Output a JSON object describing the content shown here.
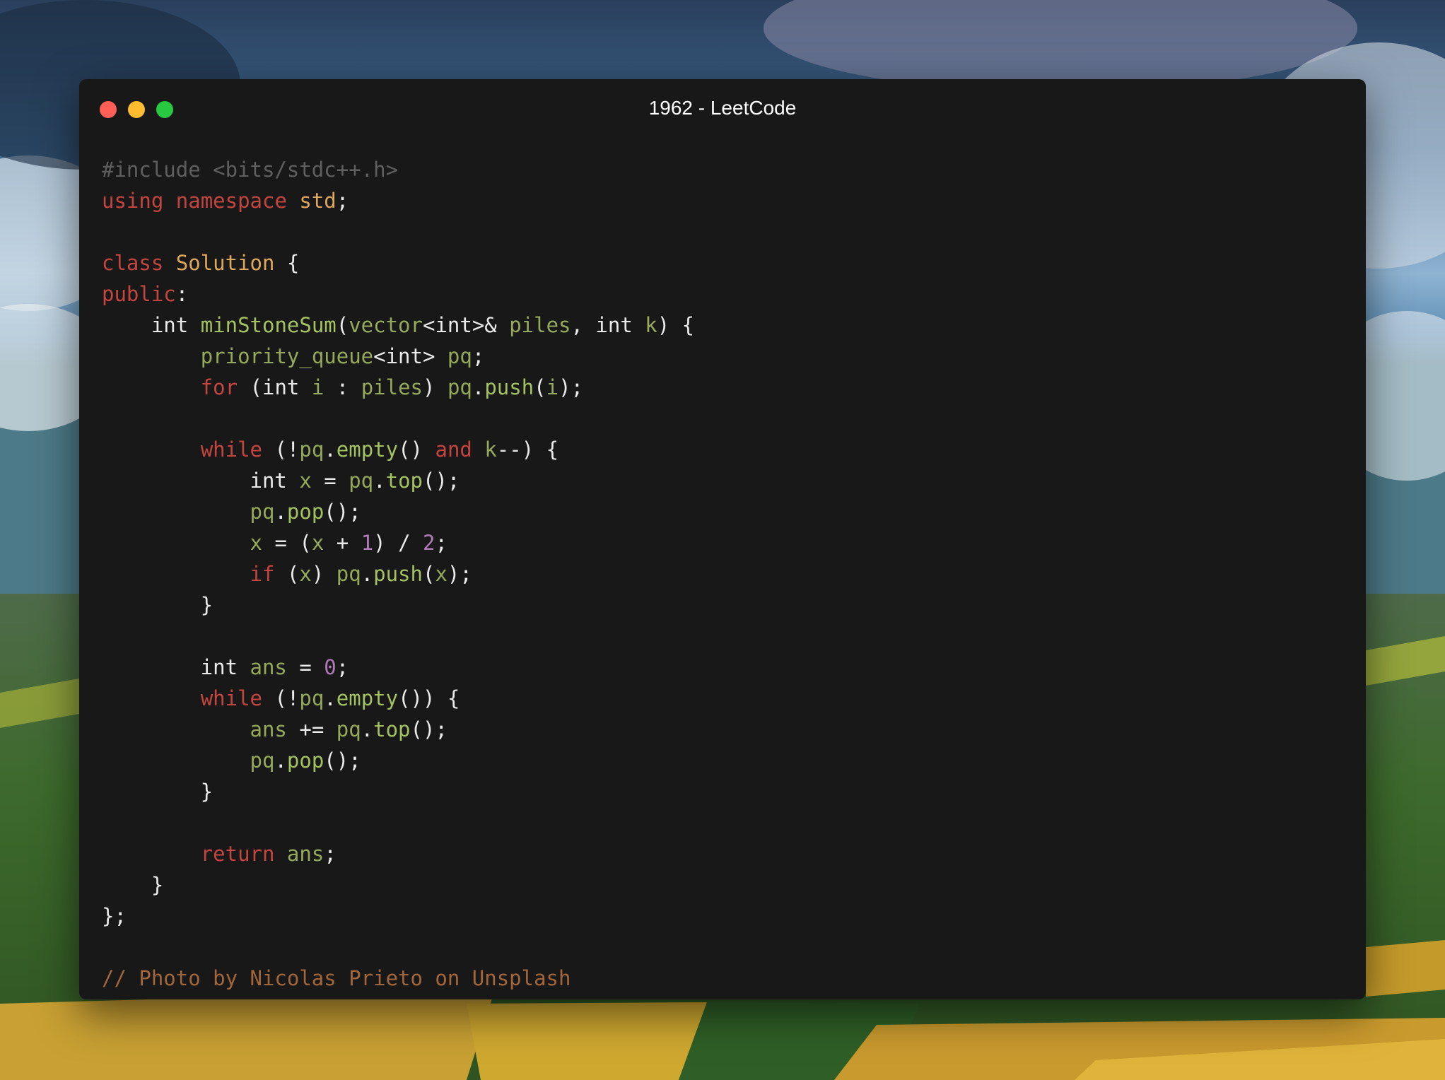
{
  "window": {
    "title": "1962 - LeetCode"
  },
  "colors": {
    "window_bg": "#181818",
    "keyword": "#c4453f",
    "type": "#e0a85a",
    "function": "#a5c261",
    "identifier": "#96a95a",
    "number": "#b07ab8",
    "comment": "#5f5f5f",
    "footer_comment": "#a2663a",
    "plain": "#eaeaea",
    "traffic_red": "#ff5f57",
    "traffic_yellow": "#febc2e",
    "traffic_green": "#28c840"
  },
  "code": {
    "lines": [
      [
        {
          "t": "#include <bits/stdc++.h>",
          "k": "comment"
        }
      ],
      [
        {
          "t": "using",
          "k": "keyword"
        },
        {
          "t": " ",
          "k": "plain"
        },
        {
          "t": "namespace",
          "k": "keyword"
        },
        {
          "t": " ",
          "k": "plain"
        },
        {
          "t": "std",
          "k": "type"
        },
        {
          "t": ";",
          "k": "punct"
        }
      ],
      [],
      [
        {
          "t": "class",
          "k": "keyword"
        },
        {
          "t": " ",
          "k": "plain"
        },
        {
          "t": "Solution",
          "k": "type"
        },
        {
          "t": " {",
          "k": "punct"
        }
      ],
      [
        {
          "t": "public",
          "k": "keyword"
        },
        {
          "t": ":",
          "k": "punct"
        }
      ],
      [
        {
          "t": "    int ",
          "k": "plain"
        },
        {
          "t": "minStoneSum",
          "k": "func"
        },
        {
          "t": "(",
          "k": "punct"
        },
        {
          "t": "vector",
          "k": "ident"
        },
        {
          "t": "<int>& ",
          "k": "plain"
        },
        {
          "t": "piles",
          "k": "ident"
        },
        {
          "t": ", int ",
          "k": "plain"
        },
        {
          "t": "k",
          "k": "ident"
        },
        {
          "t": ") {",
          "k": "punct"
        }
      ],
      [
        {
          "t": "        ",
          "k": "plain"
        },
        {
          "t": "priority_queue",
          "k": "ident"
        },
        {
          "t": "<int> ",
          "k": "plain"
        },
        {
          "t": "pq",
          "k": "ident"
        },
        {
          "t": ";",
          "k": "punct"
        }
      ],
      [
        {
          "t": "        ",
          "k": "plain"
        },
        {
          "t": "for",
          "k": "keyword"
        },
        {
          "t": " (int ",
          "k": "plain"
        },
        {
          "t": "i",
          "k": "ident"
        },
        {
          "t": " : ",
          "k": "plain"
        },
        {
          "t": "piles",
          "k": "ident"
        },
        {
          "t": ") ",
          "k": "punct"
        },
        {
          "t": "pq",
          "k": "ident"
        },
        {
          "t": ".",
          "k": "punct"
        },
        {
          "t": "push",
          "k": "func"
        },
        {
          "t": "(",
          "k": "punct"
        },
        {
          "t": "i",
          "k": "ident"
        },
        {
          "t": ");",
          "k": "punct"
        }
      ],
      [],
      [
        {
          "t": "        ",
          "k": "plain"
        },
        {
          "t": "while",
          "k": "keyword"
        },
        {
          "t": " (!",
          "k": "punct"
        },
        {
          "t": "pq",
          "k": "ident"
        },
        {
          "t": ".",
          "k": "punct"
        },
        {
          "t": "empty",
          "k": "func"
        },
        {
          "t": "() ",
          "k": "punct"
        },
        {
          "t": "and",
          "k": "keyword"
        },
        {
          "t": " ",
          "k": "plain"
        },
        {
          "t": "k",
          "k": "ident"
        },
        {
          "t": "--) {",
          "k": "punct"
        }
      ],
      [
        {
          "t": "            int ",
          "k": "plain"
        },
        {
          "t": "x",
          "k": "ident"
        },
        {
          "t": " = ",
          "k": "plain"
        },
        {
          "t": "pq",
          "k": "ident"
        },
        {
          "t": ".",
          "k": "punct"
        },
        {
          "t": "top",
          "k": "func"
        },
        {
          "t": "();",
          "k": "punct"
        }
      ],
      [
        {
          "t": "            ",
          "k": "plain"
        },
        {
          "t": "pq",
          "k": "ident"
        },
        {
          "t": ".",
          "k": "punct"
        },
        {
          "t": "pop",
          "k": "func"
        },
        {
          "t": "();",
          "k": "punct"
        }
      ],
      [
        {
          "t": "            ",
          "k": "plain"
        },
        {
          "t": "x",
          "k": "ident"
        },
        {
          "t": " = (",
          "k": "plain"
        },
        {
          "t": "x",
          "k": "ident"
        },
        {
          "t": " + ",
          "k": "plain"
        },
        {
          "t": "1",
          "k": "number"
        },
        {
          "t": ") / ",
          "k": "plain"
        },
        {
          "t": "2",
          "k": "number"
        },
        {
          "t": ";",
          "k": "punct"
        }
      ],
      [
        {
          "t": "            ",
          "k": "plain"
        },
        {
          "t": "if",
          "k": "keyword"
        },
        {
          "t": " (",
          "k": "punct"
        },
        {
          "t": "x",
          "k": "ident"
        },
        {
          "t": ") ",
          "k": "punct"
        },
        {
          "t": "pq",
          "k": "ident"
        },
        {
          "t": ".",
          "k": "punct"
        },
        {
          "t": "push",
          "k": "func"
        },
        {
          "t": "(",
          "k": "punct"
        },
        {
          "t": "x",
          "k": "ident"
        },
        {
          "t": ");",
          "k": "punct"
        }
      ],
      [
        {
          "t": "        }",
          "k": "punct"
        }
      ],
      [],
      [
        {
          "t": "        int ",
          "k": "plain"
        },
        {
          "t": "ans",
          "k": "ident"
        },
        {
          "t": " = ",
          "k": "plain"
        },
        {
          "t": "0",
          "k": "number"
        },
        {
          "t": ";",
          "k": "punct"
        }
      ],
      [
        {
          "t": "        ",
          "k": "plain"
        },
        {
          "t": "while",
          "k": "keyword"
        },
        {
          "t": " (!",
          "k": "punct"
        },
        {
          "t": "pq",
          "k": "ident"
        },
        {
          "t": ".",
          "k": "punct"
        },
        {
          "t": "empty",
          "k": "func"
        },
        {
          "t": "()) {",
          "k": "punct"
        }
      ],
      [
        {
          "t": "            ",
          "k": "plain"
        },
        {
          "t": "ans",
          "k": "ident"
        },
        {
          "t": " += ",
          "k": "plain"
        },
        {
          "t": "pq",
          "k": "ident"
        },
        {
          "t": ".",
          "k": "punct"
        },
        {
          "t": "top",
          "k": "func"
        },
        {
          "t": "();",
          "k": "punct"
        }
      ],
      [
        {
          "t": "            ",
          "k": "plain"
        },
        {
          "t": "pq",
          "k": "ident"
        },
        {
          "t": ".",
          "k": "punct"
        },
        {
          "t": "pop",
          "k": "func"
        },
        {
          "t": "();",
          "k": "punct"
        }
      ],
      [
        {
          "t": "        }",
          "k": "punct"
        }
      ],
      [],
      [
        {
          "t": "        ",
          "k": "plain"
        },
        {
          "t": "return",
          "k": "keyword"
        },
        {
          "t": " ",
          "k": "plain"
        },
        {
          "t": "ans",
          "k": "ident"
        },
        {
          "t": ";",
          "k": "punct"
        }
      ],
      [
        {
          "t": "    }",
          "k": "punct"
        }
      ],
      [
        {
          "t": "};",
          "k": "punct"
        }
      ],
      [],
      [
        {
          "t": "// Photo by Nicolas Prieto on Unsplash",
          "k": "footer"
        }
      ]
    ]
  }
}
